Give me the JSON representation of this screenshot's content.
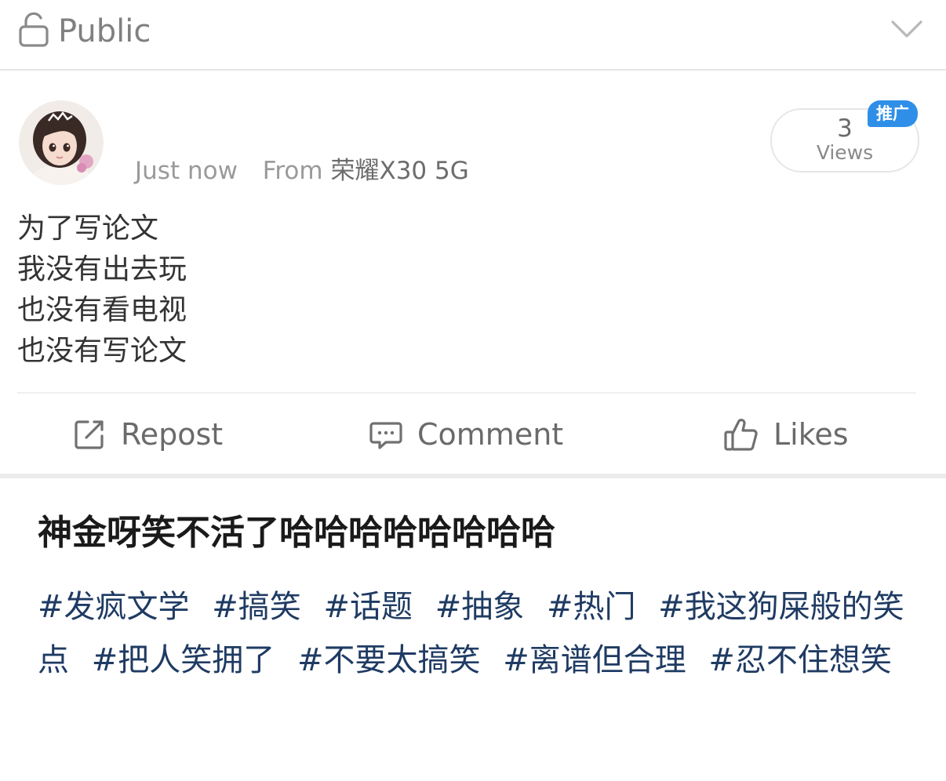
{
  "visibility": {
    "label": "Public",
    "icon": "unlock-icon",
    "expand_icon": "chevron-down-icon"
  },
  "post": {
    "timestamp": "Just now",
    "from_label": "From",
    "device": "荣耀X30 5G",
    "views": {
      "count": "3",
      "label": "Views"
    },
    "promo_badge": "推广",
    "body_lines": [
      "为了写论文",
      "我没有出去玩",
      "也没有看电视",
      "也没有写论文"
    ],
    "actions": {
      "repost": "Repost",
      "comment": "Comment",
      "likes": "Likes"
    }
  },
  "caption": {
    "title": "神金呀笑不活了哈哈哈哈哈哈哈哈",
    "tags": [
      "#发疯文学",
      "#搞笑",
      "#话题",
      "#抽象",
      "#热门",
      "#我这狗屎般的笑点",
      "#把人笑拥了",
      "#不要太搞笑",
      "#离谱但合理",
      "#忍不住想笑"
    ]
  },
  "colors": {
    "tag_text": "#1f3b63",
    "badge_blue": "#2f8fe8",
    "meta_gray": "#9a9a9a"
  }
}
